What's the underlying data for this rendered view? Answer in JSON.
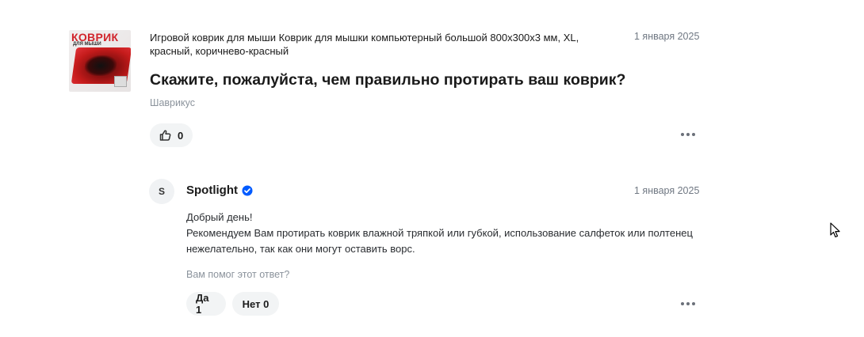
{
  "question_card": {
    "product_image_text": {
      "line1": "КОВРИК",
      "line2": "ДЛЯ МЫШИ"
    },
    "product_name": "Игровой коврик для мыши Коврик для мышки компьютерный большой 800х300х3 мм, XL, красный, коричнево-красный",
    "date": "1 января 2025",
    "question": "Скажите, пожалуйста, чем правильно протирать ваш коврик?",
    "author": "Шаврикус",
    "likes": "0"
  },
  "answer_card": {
    "avatar_letter": "S",
    "seller_name": "Spotlight",
    "date": "1 января 2025",
    "text": "Добрый день!\nРекомендуем Вам протирать коврик влажной тряпкой или губкой, использование салфеток или полтенец нежелательно, так как они могут оставить ворс.",
    "helpful_prompt": "Вам помог этот ответ?",
    "yes_label": "Да 1",
    "no_label": "Нет 0"
  },
  "colors": {
    "verified_badge": "#005bff",
    "muted_text": "#8b939c"
  },
  "icons": {
    "like": "thumbs-up-icon",
    "more": "more-dots-icon",
    "verified": "verified-check-icon",
    "cursor": "mouse-cursor-icon"
  }
}
